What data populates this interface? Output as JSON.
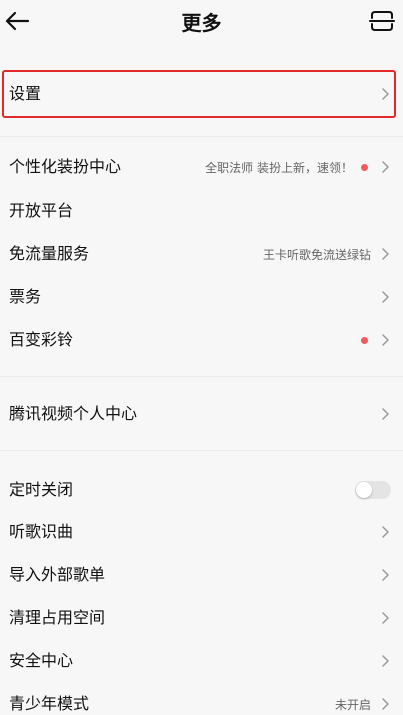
{
  "header": {
    "title": "更多",
    "back_icon": "back-arrow-icon",
    "scan_icon": "scan-icon"
  },
  "settings": {
    "label": "设置"
  },
  "section1": {
    "items": [
      {
        "label": "个性化装扮中心",
        "note": "全职法师 装扮上新，速领！",
        "has_dot": true
      },
      {
        "label": "开放平台",
        "note": "",
        "has_dot": false
      },
      {
        "label": "免流量服务",
        "note": "王卡听歌免流送绿钻",
        "has_dot": false
      },
      {
        "label": "票务",
        "note": "",
        "has_dot": false
      },
      {
        "label": "百变彩铃",
        "note": "",
        "has_dot": true
      }
    ]
  },
  "section2": {
    "items": [
      {
        "label": "腾讯视频个人中心"
      }
    ]
  },
  "section3": {
    "items": [
      {
        "label": "定时关闭",
        "toggle_on": false
      },
      {
        "label": "听歌识曲"
      },
      {
        "label": "导入外部歌单"
      },
      {
        "label": "清理占用空间"
      },
      {
        "label": "安全中心"
      },
      {
        "label": "青少年模式",
        "note": "未开启"
      }
    ]
  },
  "colors": {
    "accent_dot": "#ef5b5b",
    "highlight_border": "#e22a2a",
    "background": "#f7f7f7"
  }
}
